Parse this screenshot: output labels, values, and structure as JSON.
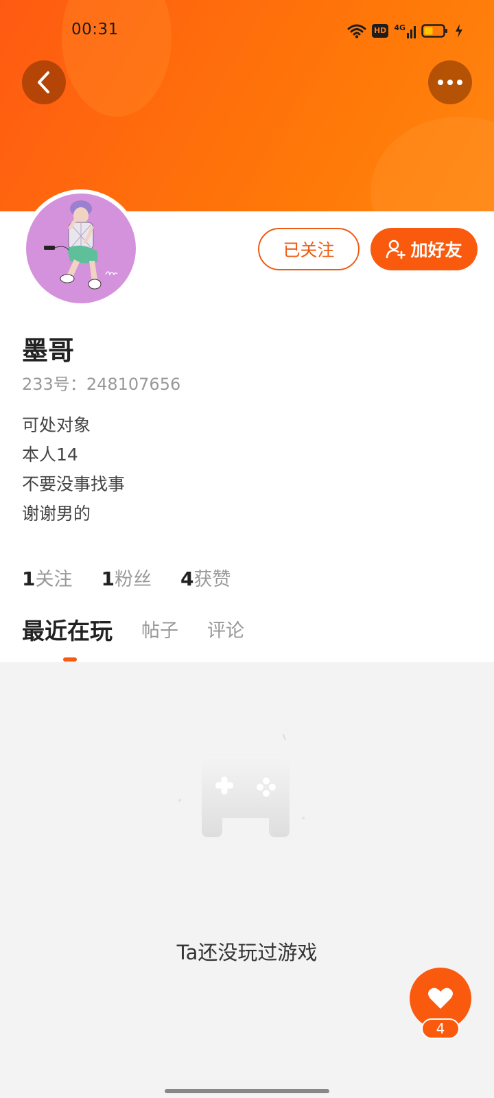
{
  "status_bar": {
    "time": "00:31",
    "hd_label": "HD",
    "network_label": "4G"
  },
  "header": {
    "back_icon": "chevron-left-icon",
    "more_icon": "more-dots-icon"
  },
  "profile": {
    "avatar_icon": "avatar-illustration",
    "follow_label": "已关注",
    "add_friend_label": "加好友",
    "name": "墨哥",
    "id_prefix": "233号：",
    "id_value": "248107656",
    "bio": [
      "可处对象",
      "本人14",
      "不要没事找事",
      "谢谢男的"
    ]
  },
  "stats": [
    {
      "count": "1",
      "label": "关注"
    },
    {
      "count": "1",
      "label": "粉丝"
    },
    {
      "count": "4",
      "label": "获赞"
    }
  ],
  "tabs": [
    {
      "label": "最近在玩",
      "active": true
    },
    {
      "label": "帖子",
      "active": false
    },
    {
      "label": "评论",
      "active": false
    }
  ],
  "empty_state": {
    "icon": "gamepad-icon",
    "text": "Ta还没玩过游戏"
  },
  "like_fab": {
    "icon": "heart-icon",
    "count": "4"
  },
  "colors": {
    "accent": "#fa5a0e",
    "banner_start": "#ff5a12",
    "banner_end": "#ff8612",
    "avatar_bg": "#d592dc",
    "content_bg": "#f3f3f3"
  }
}
